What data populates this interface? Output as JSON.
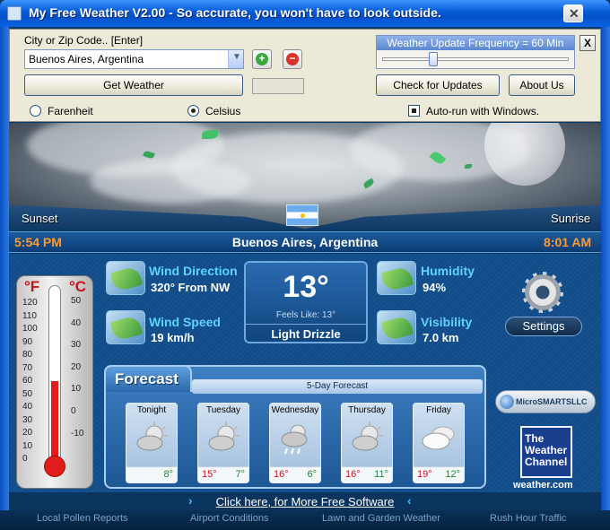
{
  "window": {
    "title": "My Free Weather V2.00  -  So accurate, you won't have to look outside."
  },
  "controls": {
    "city_label": "City or Zip Code..  [Enter]",
    "city_value": "Buenos Aires, Argentina",
    "get_weather": "Get Weather",
    "fahrenheit": "Farenheit",
    "celsius": "Celsius",
    "unit_selected": "celsius",
    "frequency_label": "Weather Update Frequency = 60 Min",
    "frequency_minutes": 60,
    "check_updates": "Check for Updates",
    "about": "About Us",
    "autorun": "Auto-run with Windows.",
    "autorun_checked": true,
    "close_panel": "X"
  },
  "sky": {
    "sunset_label": "Sunset",
    "sunrise_label": "Sunrise"
  },
  "location": {
    "sunset_time": "5:54 PM",
    "city": "Buenos Aires, Argentina",
    "sunrise_time": "8:01 AM"
  },
  "thermometer": {
    "f_label": "°F",
    "c_label": "°C",
    "f_ticks": [
      "120",
      "110",
      "100",
      "90",
      "80",
      "70",
      "60",
      "50",
      "40",
      "30",
      "20",
      "10",
      "0"
    ],
    "c_ticks": [
      "50",
      "40",
      "30",
      "20",
      "10",
      "0",
      "-10"
    ],
    "level_celsius": 13
  },
  "current": {
    "wind_direction_title": "Wind Direction",
    "wind_direction_value": "320° From NW",
    "wind_speed_title": "Wind Speed",
    "wind_speed_value": "19 km/h",
    "temperature": "13°",
    "feels_like": "Feels Like: 13°",
    "condition": "Light Drizzle",
    "humidity_title": "Humidity",
    "humidity_value": "94%",
    "visibility_title": "Visibility",
    "visibility_value": "7.0 km",
    "settings": "Settings"
  },
  "forecast": {
    "title": "Forecast",
    "subtitle": "5-Day Forecast",
    "days": [
      {
        "name": "Tonight",
        "hi": "",
        "lo": "8°",
        "icon": "partly-cloudy-icon"
      },
      {
        "name": "Tuesday",
        "hi": "15°",
        "lo": "7°",
        "icon": "partly-cloudy-icon"
      },
      {
        "name": "Wednesday",
        "hi": "16°",
        "lo": "6°",
        "icon": "rain-icon"
      },
      {
        "name": "Thursday",
        "hi": "16°",
        "lo": "11°",
        "icon": "partly-cloudy-icon"
      },
      {
        "name": "Friday",
        "hi": "19°",
        "lo": "12°",
        "icon": "cloudy-icon"
      }
    ]
  },
  "branding": {
    "microsmarts": "MicroSMARTSLLC",
    "twc_text": "The Weather Channel",
    "twc_url": "weather.com"
  },
  "links": {
    "more_software": "Click here, for More Free Software",
    "footer": [
      "Local Pollen Reports",
      "Airport Conditions",
      "Lawn and Garden Weather",
      "Rush Hour Traffic"
    ]
  },
  "colors": {
    "accent": "#ff9a2e",
    "title_blue": "#5fd3ff",
    "hi_red": "#c8181e",
    "lo_green": "#1b8a2d"
  }
}
